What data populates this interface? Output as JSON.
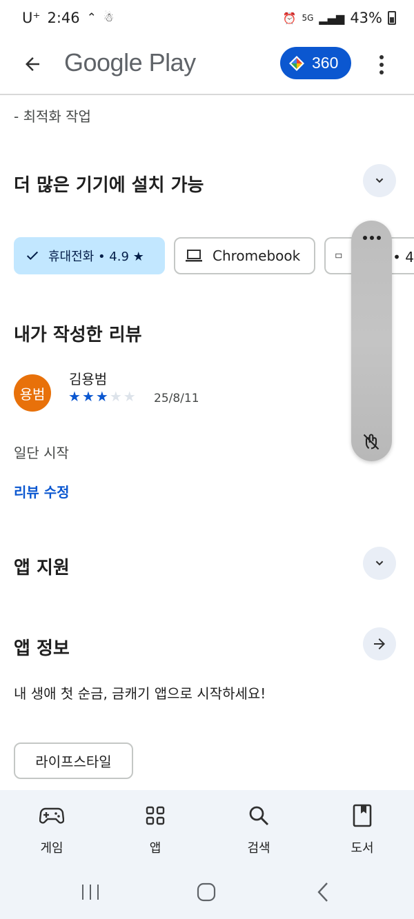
{
  "status_bar": {
    "carrier": "U⁺",
    "time": "2:46",
    "network": "5G",
    "battery": "43%"
  },
  "app_bar": {
    "title": "Google Play",
    "points": "360"
  },
  "description_tail": "- 최적화 작업",
  "devices_section": {
    "title": "더 많은 기기에 설치 가능",
    "chips": [
      {
        "label": "휴대전화 • 4.9 ★",
        "selected": true
      },
      {
        "label": "Chromebook",
        "selected": false
      },
      {
        "label": "태블릿 • 4",
        "selected": false
      }
    ]
  },
  "my_review": {
    "title": "내가 작성한 리뷰",
    "avatar_text": "용범",
    "author": "김용범",
    "rating": 3,
    "max_rating": 5,
    "date": "25/8/11",
    "text": "일단 시작",
    "edit_link": "리뷰 수정"
  },
  "app_support": {
    "title": "앱 지원"
  },
  "app_info": {
    "title": "앱 정보",
    "description": "내 생애 첫 순금, 금캐기 앱으로 시작하세요!",
    "category_chip": "라이프스타일"
  },
  "bottom_nav": {
    "items": [
      {
        "label": "게임",
        "icon": "gamepad-icon"
      },
      {
        "label": "앱",
        "icon": "apps-grid-icon"
      },
      {
        "label": "검색",
        "icon": "search-icon"
      },
      {
        "label": "도서",
        "icon": "book-icon"
      }
    ]
  },
  "colors": {
    "accent": "#0b57d0",
    "selected_chip": "#c2e7ff",
    "avatar": "#e8710a",
    "nav_background": "#f0f4f9"
  }
}
